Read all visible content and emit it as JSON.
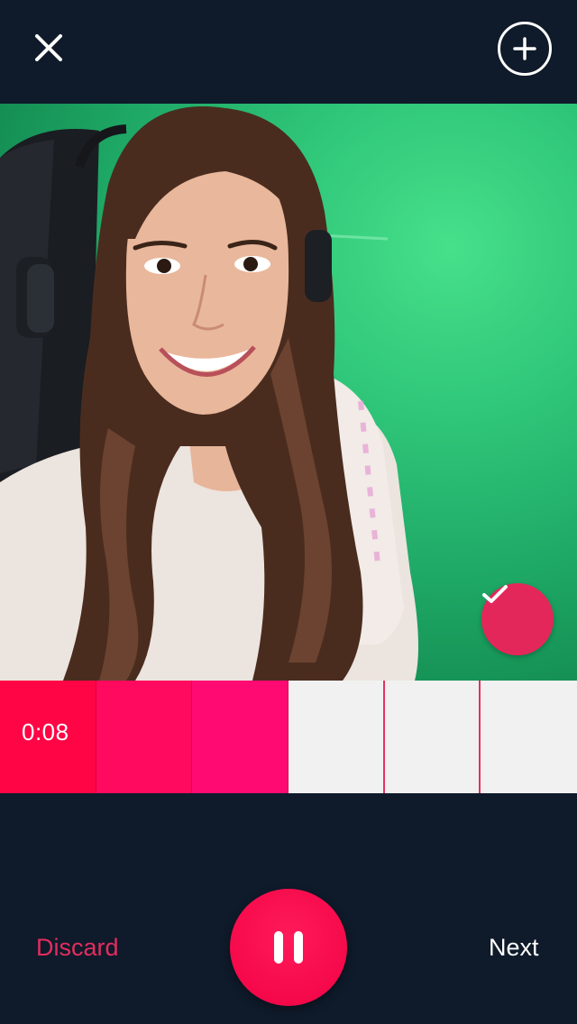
{
  "icons": {
    "close": "close-icon",
    "add": "plus-circle-icon",
    "confirm": "checkmark-icon",
    "pause": "pause-icon"
  },
  "colors": {
    "background": "#0f1a2a",
    "accent": "#f5094a",
    "discard_text": "#e32d5e",
    "check_button": "#e4275a",
    "progress_empty": "#f1f1f1"
  },
  "recorder": {
    "elapsed": "0:08",
    "segments": [
      {
        "state": "recorded",
        "color": "#ff0545"
      },
      {
        "state": "recorded",
        "color": "#ff0a5e"
      },
      {
        "state": "recorded",
        "color": "#ff0a72"
      },
      {
        "state": "empty"
      },
      {
        "state": "empty"
      },
      {
        "state": "empty"
      }
    ],
    "recorded_fraction": 0.5
  },
  "controls": {
    "discard_label": "Discard",
    "next_label": "Next"
  }
}
